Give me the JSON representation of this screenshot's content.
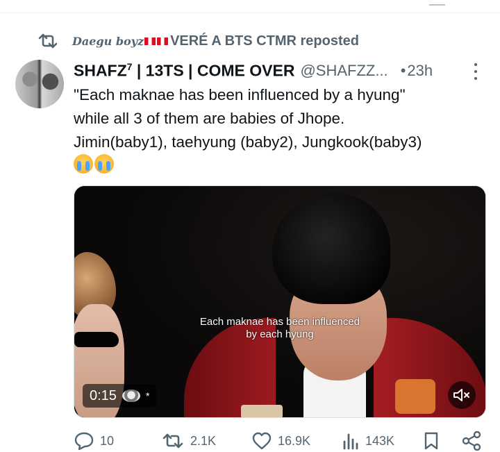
{
  "repost": {
    "name": "Daegu boyz",
    "rest": "VERÉ A BTS CTMR reposted"
  },
  "tweet": {
    "author_name": "SHAFZ",
    "author_superscript": "7",
    "author_suffix": " | 13TS | COME OVER",
    "handle": "@SHAFZZ...",
    "dot": "•",
    "time": "23h",
    "text_lines": [
      "\"Each maknae has been influenced by a hyung\"",
      "while all 3 of them are babies of Jhope.",
      "Jimin(baby1), taehyung (baby2), Jungkook(baby3)"
    ]
  },
  "video": {
    "caption_line1": "Each maknae has been influenced",
    "caption_line2": "by each hyung",
    "timestamp": "0:15",
    "star": "*"
  },
  "actions": {
    "replies": "10",
    "reposts": "2.1K",
    "likes": "16.9K",
    "views": "143K"
  },
  "colors": {
    "text_primary": "#0f1419",
    "text_secondary": "#536471",
    "divider": "#eff3f4"
  },
  "icons": [
    "repost-icon",
    "more-icon",
    "crying-emoji",
    "mute-icon",
    "reply-icon",
    "like-icon",
    "views-icon",
    "bookmark-icon",
    "share-icon"
  ]
}
